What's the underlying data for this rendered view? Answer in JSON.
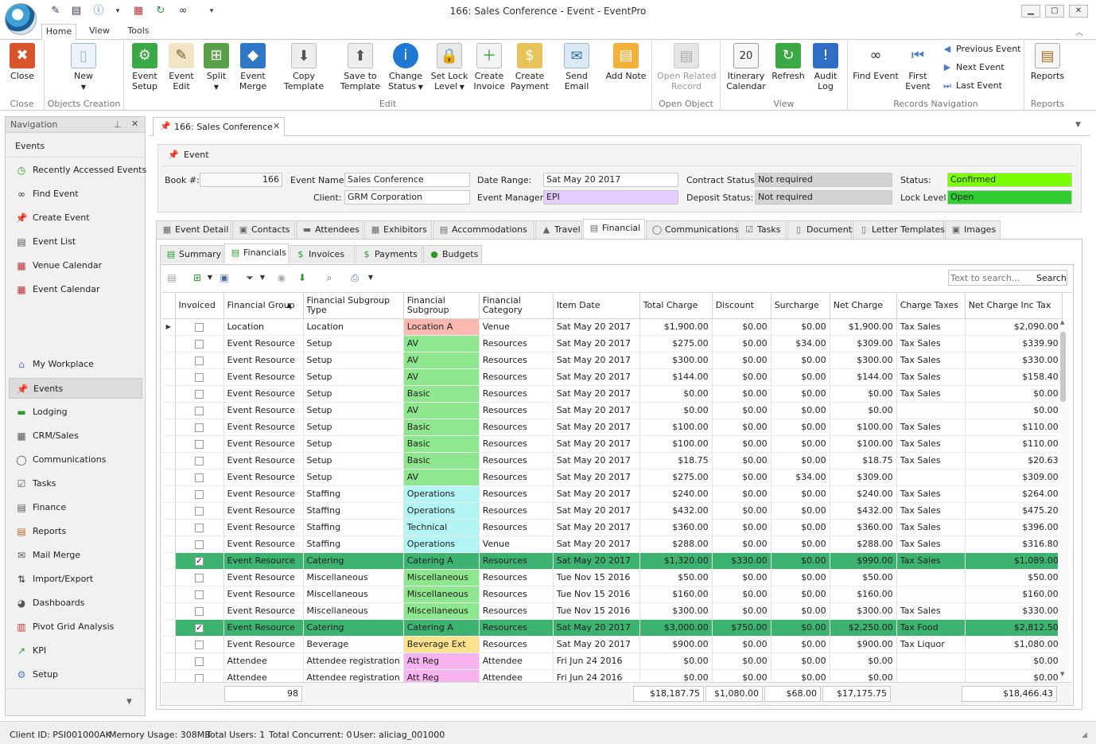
{
  "window": {
    "title": "166: Sales Conference - Event - EventPro"
  },
  "ribbon": {
    "tabs": [
      "Home",
      "View",
      "Tools"
    ],
    "groups": {
      "close": "Close",
      "objects": "Objects Creation",
      "edit": "Edit",
      "open_object": "Open Object",
      "view": "View",
      "records": "Records Navigation",
      "reports": "Reports"
    },
    "buttons": {
      "close": "Close",
      "new": "New",
      "event_setup": "Event\nSetup",
      "event_edit": "Event\nEdit",
      "split": "Split",
      "event_merge": "Event\nMerge",
      "copy_template": "Copy Template",
      "save_template": "Save to\nTemplate",
      "change_status": "Change\nStatus",
      "set_lock": "Set Lock\nLevel",
      "create_invoice": "Create\nInvoice",
      "create_payment": "Create\nPayment",
      "send_email": "Send Email",
      "add_note": "Add Note",
      "open_related": "Open Related\nRecord",
      "itinerary": "Itinerary\nCalendar",
      "refresh": "Refresh",
      "audit_log": "Audit\nLog",
      "find_event": "Find Event",
      "first_event": "First\nEvent",
      "previous_event": "Previous Event",
      "next_event": "Next Event",
      "last_event": "Last Event",
      "reports": "Reports"
    }
  },
  "nav": {
    "title": "Navigation",
    "section": "Events",
    "top_items": [
      "Recently Accessed Events",
      "Find Event",
      "Create Event",
      "Event List",
      "Venue Calendar",
      "Event Calendar"
    ],
    "modules": [
      "My Workplace",
      "Events",
      "Lodging",
      "CRM/Sales",
      "Communications",
      "Tasks",
      "Finance",
      "Reports",
      "Mail Merge",
      "Import/Export",
      "Dashboards",
      "Pivot Grid Analysis",
      "KPI",
      "Setup"
    ],
    "selected_module": "Events"
  },
  "doc_tab": {
    "label": "166: Sales Conference"
  },
  "event": {
    "panel_title": "Event",
    "book_label": "Book #:",
    "book": "166",
    "name_label": "Event Name:",
    "name": "Sales Conference",
    "client_label": "Client:",
    "client": "GRM Corporation",
    "date_label": "Date Range:",
    "date_range": "Sat May 20 2017",
    "manager_label": "Event Manager:",
    "manager": "EPI",
    "contract_label": "Contract Status:",
    "contract_status": "Not required",
    "deposit_label": "Deposit Status:",
    "deposit_status": "Not required",
    "status_label": "Status:",
    "status": "Confirmed",
    "lock_label": "Lock Level:",
    "lock_level": "Open",
    "colors": {
      "status": "#7cfc00",
      "lock": "#32cd32",
      "manager": "#e6ccff",
      "gray": "#d3d3d3"
    }
  },
  "event_tabs": [
    "Event Detail",
    "Contacts",
    "Attendees",
    "Exhibitors",
    "Accommodations",
    "Travel",
    "Financial",
    "Communications",
    "Tasks",
    "Documents",
    "Letter Templates",
    "Images"
  ],
  "selected_event_tab": "Financial",
  "sub_tabs": [
    "Summary",
    "Financials",
    "Invoices",
    "Payments",
    "Budgets"
  ],
  "selected_sub_tab": "Financials",
  "search": {
    "placeholder": "Text to search...",
    "button": "Search"
  },
  "grid": {
    "columns": [
      "Invoiced",
      "Financial Group",
      "Financial Subgroup Type",
      "Financial Subgroup",
      "Financial Category",
      "Item Date",
      "Total Charge",
      "Discount",
      "Surcharge",
      "Net Charge",
      "Charge Taxes",
      "Net Charge Inc Tax"
    ],
    "subgroup_colors": {
      "Location A": "#f9b8b0",
      "AV": "#8ee68e",
      "Basic": "#8ee68e",
      "Operations": "#b3f5f5",
      "Technical": "#b3f5f5",
      "Miscellaneous": "#8ee68e",
      "Catering A": "#ffd6a5",
      "Beverage Ext": "#fbe38e",
      "Att Reg": "#f8b4f0"
    },
    "rows": [
      [
        false,
        "Location",
        "Location",
        "Location A",
        "Venue",
        "Sat May 20 2017",
        "$1,900.00",
        "$0.00",
        "$0.00",
        "$1,900.00",
        "Tax Sales",
        "$2,090.00"
      ],
      [
        false,
        "Event Resource",
        "Setup",
        "AV",
        "Resources",
        "Sat May 20 2017",
        "$275.00",
        "$0.00",
        "$34.00",
        "$309.00",
        "Tax Sales",
        "$339.90"
      ],
      [
        false,
        "Event Resource",
        "Setup",
        "AV",
        "Resources",
        "Sat May 20 2017",
        "$300.00",
        "$0.00",
        "$0.00",
        "$300.00",
        "Tax Sales",
        "$330.00"
      ],
      [
        false,
        "Event Resource",
        "Setup",
        "AV",
        "Resources",
        "Sat May 20 2017",
        "$144.00",
        "$0.00",
        "$0.00",
        "$144.00",
        "Tax Sales",
        "$158.40"
      ],
      [
        false,
        "Event Resource",
        "Setup",
        "Basic",
        "Resources",
        "Sat May 20 2017",
        "$0.00",
        "$0.00",
        "$0.00",
        "$0.00",
        "Tax Sales",
        "$0.00"
      ],
      [
        false,
        "Event Resource",
        "Setup",
        "AV",
        "Resources",
        "Sat May 20 2017",
        "$0.00",
        "$0.00",
        "$0.00",
        "$0.00",
        "",
        "$0.00"
      ],
      [
        false,
        "Event Resource",
        "Setup",
        "Basic",
        "Resources",
        "Sat May 20 2017",
        "$100.00",
        "$0.00",
        "$0.00",
        "$100.00",
        "Tax Sales",
        "$110.00"
      ],
      [
        false,
        "Event Resource",
        "Setup",
        "Basic",
        "Resources",
        "Sat May 20 2017",
        "$100.00",
        "$0.00",
        "$0.00",
        "$100.00",
        "Tax Sales",
        "$110.00"
      ],
      [
        false,
        "Event Resource",
        "Setup",
        "Basic",
        "Resources",
        "Sat May 20 2017",
        "$18.75",
        "$0.00",
        "$0.00",
        "$18.75",
        "Tax Sales",
        "$20.63"
      ],
      [
        false,
        "Event Resource",
        "Setup",
        "AV",
        "Resources",
        "Sat May 20 2017",
        "$275.00",
        "$0.00",
        "$34.00",
        "$309.00",
        "",
        "$309.00"
      ],
      [
        false,
        "Event Resource",
        "Staffing",
        "Operations",
        "Resources",
        "Sat May 20 2017",
        "$240.00",
        "$0.00",
        "$0.00",
        "$240.00",
        "Tax Sales",
        "$264.00"
      ],
      [
        false,
        "Event Resource",
        "Staffing",
        "Operations",
        "Resources",
        "Sat May 20 2017",
        "$432.00",
        "$0.00",
        "$0.00",
        "$432.00",
        "Tax Sales",
        "$475.20"
      ],
      [
        false,
        "Event Resource",
        "Staffing",
        "Technical",
        "Resources",
        "Sat May 20 2017",
        "$360.00",
        "$0.00",
        "$0.00",
        "$360.00",
        "Tax Sales",
        "$396.00"
      ],
      [
        false,
        "Event Resource",
        "Staffing",
        "Operations",
        "Venue",
        "Sat May 20 2017",
        "$288.00",
        "$0.00",
        "$0.00",
        "$288.00",
        "Tax Sales",
        "$316.80"
      ],
      [
        true,
        "Event Resource",
        "Catering",
        "Catering A",
        "Resources",
        "Sat May 20 2017",
        "$1,320.00",
        "$330.00",
        "$0.00",
        "$990.00",
        "Tax Sales",
        "$1,089.00"
      ],
      [
        false,
        "Event Resource",
        "Miscellaneous",
        "Miscellaneous",
        "Resources",
        "Tue Nov 15 2016",
        "$50.00",
        "$0.00",
        "$0.00",
        "$50.00",
        "",
        "$50.00"
      ],
      [
        false,
        "Event Resource",
        "Miscellaneous",
        "Miscellaneous",
        "Resources",
        "Tue Nov 15 2016",
        "$160.00",
        "$0.00",
        "$0.00",
        "$160.00",
        "",
        "$160.00"
      ],
      [
        false,
        "Event Resource",
        "Miscellaneous",
        "Miscellaneous",
        "Resources",
        "Tue Nov 15 2016",
        "$300.00",
        "$0.00",
        "$0.00",
        "$300.00",
        "Tax Sales",
        "$330.00"
      ],
      [
        true,
        "Event Resource",
        "Catering",
        "Catering A",
        "Resources",
        "Sat May 20 2017",
        "$3,000.00",
        "$750.00",
        "$0.00",
        "$2,250.00",
        "Tax Food",
        "$2,812.50"
      ],
      [
        false,
        "Event Resource",
        "Beverage",
        "Beverage Ext",
        "Resources",
        "Sat May 20 2017",
        "$900.00",
        "$0.00",
        "$0.00",
        "$900.00",
        "Tax Liquor",
        "$1,080.00"
      ],
      [
        false,
        "Attendee",
        "Attendee registration",
        "Att Reg",
        "Attendee",
        "Fri Jun 24 2016",
        "$0.00",
        "$0.00",
        "$0.00",
        "$0.00",
        "",
        "$0.00"
      ],
      [
        false,
        "Attendee",
        "Attendee registration",
        "Att Reg",
        "Attendee",
        "Fri Jun 24 2016",
        "$0.00",
        "$0.00",
        "$0.00",
        "$0.00",
        "",
        "$0.00"
      ]
    ],
    "totals": {
      "count": "98",
      "total_charge": "$18,187.75",
      "discount": "$1,080.00",
      "surcharge": "$68.00",
      "net_charge": "$17,175.75",
      "net_inc_tax": "$18,466.43"
    },
    "highlight_color": "#3cb371"
  },
  "statusbar": {
    "client_id": "Client ID: PSI001000AK",
    "memory": "Memory Usage: 308MB",
    "total_users": "Total Users: 1",
    "concurrent": "Total Concurrent: 0",
    "user": "User: aliciag_001000"
  }
}
